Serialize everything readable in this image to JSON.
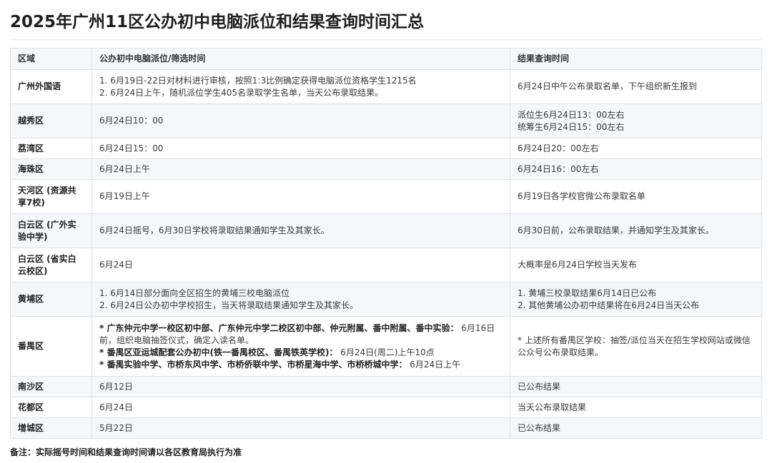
{
  "title": "2025年广州11区公办初中电脑派位和结果查询时间汇总",
  "headers": [
    "区域",
    "公办初中电脑派位/筛选时间",
    "结果查询时间"
  ],
  "rows": [
    {
      "region": "广州外国语",
      "time": [
        "1. 6月19日-22日对材料进行审核，按照1:3比例确定获得电脑派位资格学生1215名",
        "2. 6月24日上午，随机派位学生405名录取学生名单，当天公布录取结果。"
      ],
      "result": [
        "6月24日中午公布录取名单，下午组织新生报到"
      ]
    },
    {
      "region": "越秀区",
      "time": [
        "6月24日10：00"
      ],
      "result": [
        "派位生6月24日13：00左右",
        "统筹生6月24日15：00左右"
      ]
    },
    {
      "region": "荔湾区",
      "time": [
        "6月24日15：00"
      ],
      "result": [
        "6月24日20：00左右"
      ]
    },
    {
      "region": "海珠区",
      "time": [
        "6月24日上午"
      ],
      "result": [
        "6月24日16：00左右"
      ]
    },
    {
      "region": "天河区 (资源共享7校)",
      "time": [
        "6月19日上午"
      ],
      "result": [
        "6月19日各学校官微公布录取名单"
      ]
    },
    {
      "region": "白云区 (广外实验中学)",
      "time": [
        "6月24日摇号，6月30日学校将录取结果通知学生及其家长。"
      ],
      "result": [
        "6月30日前，公布录取结果，并通知学生及其家长。"
      ]
    },
    {
      "region": "白云区 (省实白云校区)",
      "time": [
        "6月24日"
      ],
      "result": [
        "大概率是6月24日学校当天发布"
      ]
    },
    {
      "region": "黄埔区",
      "time": [
        "1. 6月14日部分面向全区招生的黄埔三校电脑派位",
        "2. 6月24日公办初中学校招生，当天将录取结果通知学生及其家长。"
      ],
      "result": [
        "1. 黄埔三校录取结果6月14日已公布",
        "2. 其他黄埔公办初中结果将在6月24日当天公布"
      ]
    },
    {
      "region": "番禺区",
      "panyu_items": [
        {
          "bold": "* 广东仲元中学一校区初中部、广东仲元中学二校区初中部、仲元附属、番中附属、番中实验：",
          "text": " 6月16日前，组织电脑抽签仪式，确定入读名单。"
        },
        {
          "bold": "* 番禺区亚运城配套公办初中(铁一番禺校区、番禺铁英学校)：",
          "text": " 6月24日(周二)上午10点"
        },
        {
          "bold": "* 番禺实验中学、市桥东风中学、市桥侨联中学、市桥星海中学、市桥桥城中学：",
          "text": " 6月24日上午"
        }
      ],
      "result_text": "* 上述所有番禺区学校：抽签/派位当天在招生学校网站或微信公众号公布录取结果。"
    },
    {
      "region": "南沙区",
      "time": [
        "6月12日"
      ],
      "result": [
        "已公布结果"
      ]
    },
    {
      "region": "花都区",
      "time": [
        "6月24日"
      ],
      "result": [
        "当天公布录取结果"
      ]
    },
    {
      "region": "增城区",
      "time": [
        "5月22日"
      ],
      "result": [
        "已公布结果"
      ]
    }
  ],
  "footnote": "备注：实际摇号时间和结果查询时间请以各区教育局执行为准"
}
